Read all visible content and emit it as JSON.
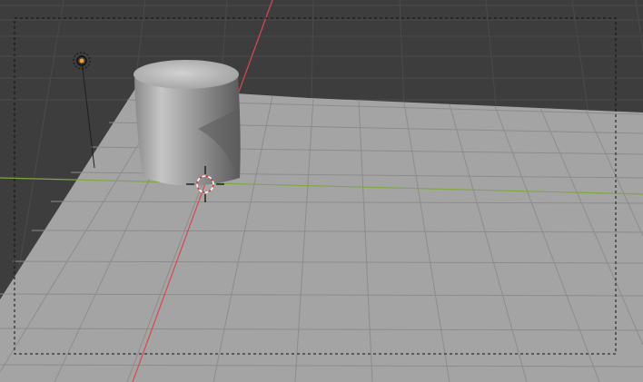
{
  "viewport": {
    "view_mode": "camera-view",
    "colors": {
      "background": "#3d3d3d",
      "grid_floor": "#4a4a4a",
      "plane": "#a4a4a4",
      "plane_grid": "#8c8c8c",
      "x_axis": "#d9484f",
      "y_axis": "#7ea843",
      "camera_frame": "#111111",
      "light": "#f59a2c",
      "cursor_red": "#d83a3a"
    },
    "objects": [
      {
        "name": "cylinder",
        "type": "mesh"
      },
      {
        "name": "plane",
        "type": "mesh"
      },
      {
        "name": "light",
        "type": "point-light"
      }
    ],
    "icons": [
      "3d-cursor-icon",
      "light-icon"
    ]
  }
}
